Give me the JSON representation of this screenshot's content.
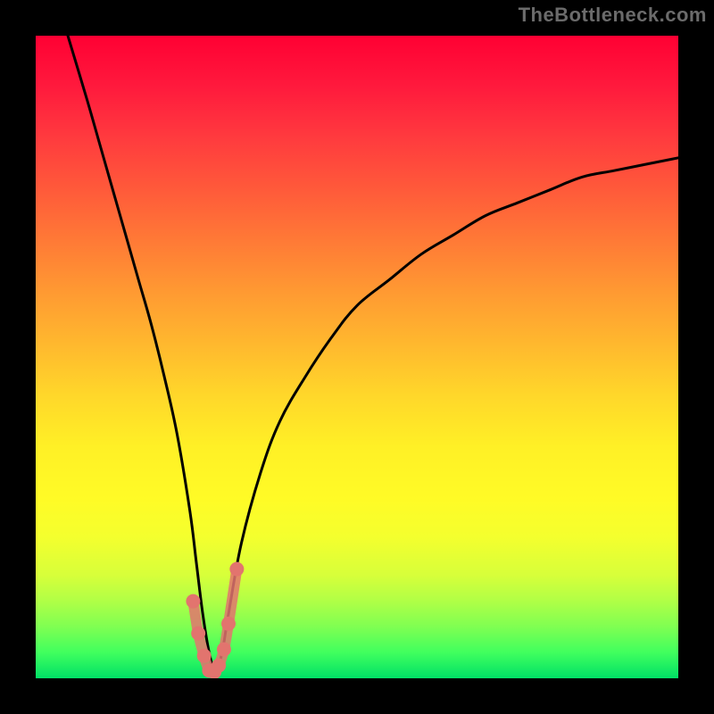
{
  "watermark": {
    "text": "TheBottleneck.com"
  },
  "chart_data": {
    "type": "line",
    "title": "",
    "xlabel": "",
    "ylabel": "",
    "xlim": [
      0,
      100
    ],
    "ylim": [
      0,
      100
    ],
    "series": [
      {
        "name": "bottleneck-curve",
        "x": [
          5,
          8,
          10,
          12,
          14,
          16,
          18,
          20,
          22,
          24,
          25,
          26,
          27,
          28,
          29,
          30,
          32,
          35,
          38,
          42,
          46,
          50,
          55,
          60,
          65,
          70,
          75,
          80,
          85,
          90,
          95,
          100
        ],
        "values": [
          100,
          90,
          83,
          76,
          69,
          62,
          55,
          47,
          38,
          26,
          18,
          10,
          4,
          1,
          4,
          10,
          21,
          32,
          40,
          47,
          53,
          58,
          62,
          66,
          69,
          72,
          74,
          76,
          78,
          79,
          80,
          81
        ]
      },
      {
        "name": "highlight-points",
        "x": [
          24.5,
          25.3,
          26.2,
          27.0,
          27.8,
          28.5,
          29.3,
          30.0,
          31.3
        ],
        "values": [
          12,
          7,
          3.5,
          1.2,
          1.0,
          2.0,
          4.5,
          8.5,
          17
        ]
      }
    ],
    "colors": {
      "curve": "#000000",
      "highlight": "#e2746e",
      "gradient_top": "#ff0033",
      "gradient_bottom": "#00e066"
    }
  }
}
